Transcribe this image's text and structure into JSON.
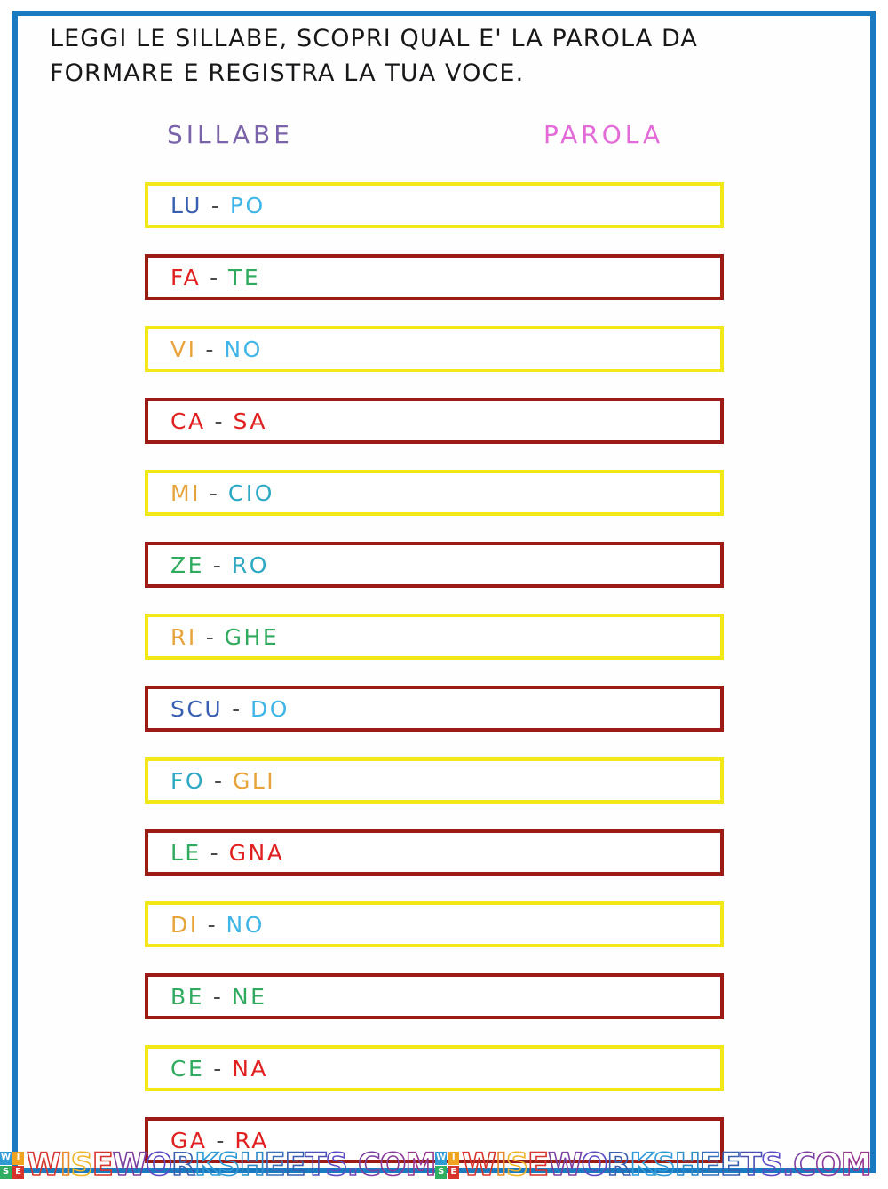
{
  "page": {
    "border_color": "#1a7ac0",
    "background": "#ffffff"
  },
  "instructions": {
    "text": "LEGGI LE SILLABE, SCOPRI QUAL E' LA PAROLA DA FORMARE E REGISTRA LA TUA VOCE.",
    "color": "#18181a"
  },
  "headers": {
    "sillabe": "SILLABE",
    "sillabe_color": "#7a63a8",
    "parola": "PAROLA",
    "parola_color": "#e26bd8"
  },
  "colors": {
    "box_yellow": "#f2e818",
    "box_darkred": "#9d1b16",
    "blue_dark": "#3a5fb0",
    "blue_light": "#3fb5e8",
    "red": "#e02020",
    "green": "#2faa5e",
    "teal": "#2fa8c4",
    "orange": "#e8a43c",
    "separator": "#4a4a4a"
  },
  "rows": [
    {
      "border": "yellow",
      "part1": "LU",
      "part1_color": "#3a5fb0",
      "separator": " - ",
      "part2": "PO",
      "part2_color": "#3fb5e8"
    },
    {
      "border": "darkred",
      "part1": "FA",
      "part1_color": "#e02020",
      "separator": " - ",
      "part2": "TE",
      "part2_color": "#2faa5e"
    },
    {
      "border": "yellow",
      "part1": "VI",
      "part1_color": "#e8a43c",
      "separator": " - ",
      "part2": "NO",
      "part2_color": "#3fb5e8"
    },
    {
      "border": "darkred",
      "part1": "CA",
      "part1_color": "#e02020",
      "separator": " - ",
      "part2": "SA",
      "part2_color": "#e02020"
    },
    {
      "border": "yellow",
      "part1": "MI",
      "part1_color": "#e8a43c",
      "separator": " - ",
      "part2": "CIO",
      "part2_color": "#2fa8c4"
    },
    {
      "border": "darkred",
      "part1": "ZE",
      "part1_color": "#2faa5e",
      "separator": " - ",
      "part2": "RO",
      "part2_color": "#2fa8c4"
    },
    {
      "border": "yellow",
      "part1": "RI",
      "part1_color": "#e8a43c",
      "separator": " - ",
      "part2": "GHE",
      "part2_color": "#2faa5e"
    },
    {
      "border": "darkred",
      "part1": "SCU",
      "part1_color": "#3a5fb0",
      "separator": " - ",
      "part2": "DO",
      "part2_color": "#3fb5e8"
    },
    {
      "border": "yellow",
      "part1": "FO",
      "part1_color": "#2fa8c4",
      "separator": " - ",
      "part2": "GLI",
      "part2_color": "#e8a43c"
    },
    {
      "border": "darkred",
      "part1": "LE",
      "part1_color": "#2faa5e",
      "separator": " - ",
      "part2": "GNA",
      "part2_color": "#e02020"
    },
    {
      "border": "yellow",
      "part1": "DI",
      "part1_color": "#e8a43c",
      "separator": " - ",
      "part2": "NO",
      "part2_color": "#3fb5e8"
    },
    {
      "border": "darkred",
      "part1": "BE",
      "part1_color": "#2faa5e",
      "separator": " - ",
      "part2": "NE",
      "part2_color": "#2faa5e"
    },
    {
      "border": "yellow",
      "part1": "CE",
      "part1_color": "#2faa5e",
      "separator": " - ",
      "part2": "NA",
      "part2_color": "#e02020"
    },
    {
      "border": "darkred",
      "part1": "GA",
      "part1_color": "#e02020",
      "separator": " - ",
      "part2": "RA",
      "part2_color": "#e02020"
    }
  ],
  "watermark": {
    "logo_letters": [
      "W",
      "I",
      "S",
      "E"
    ],
    "text": "WISEWORKSHEETS.COM",
    "letters": [
      {
        "ch": "W",
        "color": "#d6342c"
      },
      {
        "ch": "I",
        "color": "#e8892a"
      },
      {
        "ch": "S",
        "color": "#f0b429"
      },
      {
        "ch": "E",
        "color": "#d6342c"
      },
      {
        "ch": "W",
        "color": "#7b3fa0"
      },
      {
        "ch": "O",
        "color": "#5b4bc4"
      },
      {
        "ch": "R",
        "color": "#3a5fb0"
      },
      {
        "ch": "K",
        "color": "#2e9bd6"
      },
      {
        "ch": "S",
        "color": "#2e9bd6"
      },
      {
        "ch": "H",
        "color": "#2e8bc8"
      },
      {
        "ch": "E",
        "color": "#3a6fbb"
      },
      {
        "ch": "E",
        "color": "#3a5fb0"
      },
      {
        "ch": "T",
        "color": "#4a4fb4"
      },
      {
        "ch": "S",
        "color": "#5b4bc4"
      },
      {
        "ch": ".",
        "color": "#6b45b8"
      },
      {
        "ch": "C",
        "color": "#7b3fa0"
      },
      {
        "ch": "O",
        "color": "#8a3a98"
      },
      {
        "ch": "M",
        "color": "#96358f"
      }
    ],
    "repeat": 2
  }
}
